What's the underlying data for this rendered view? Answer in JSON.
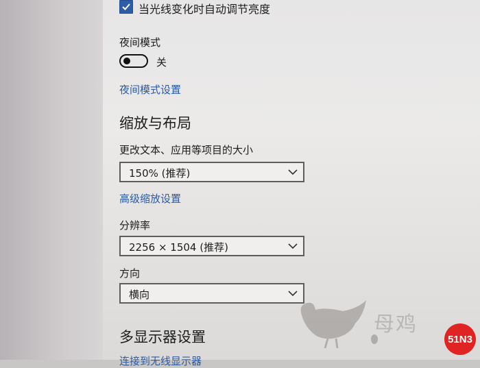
{
  "night_light_auto": {
    "checkbox_label": "当光线变化时自动调节亮度",
    "checked": true
  },
  "night_mode": {
    "label": "夜间模式",
    "toggle_state_text": "关",
    "settings_link": "夜间模式设置"
  },
  "scale_layout": {
    "heading": "缩放与布局",
    "text_size_label": "更改文本、应用等项目的大小",
    "text_size_value": "150% (推荐)",
    "advanced_link": "高级缩放设置",
    "resolution_label": "分辨率",
    "resolution_value": "2256 × 1504 (推荐)",
    "orientation_label": "方向",
    "orientation_value": "横向"
  },
  "multi_display": {
    "heading": "多显示器设置",
    "link_partial": "连接到无线显示器"
  },
  "watermark": {
    "text": "母鸡",
    "badge": "51N3"
  },
  "colors": {
    "accent": "#2d5da6",
    "link": "#2a5aa4",
    "badge": "#e02424"
  }
}
